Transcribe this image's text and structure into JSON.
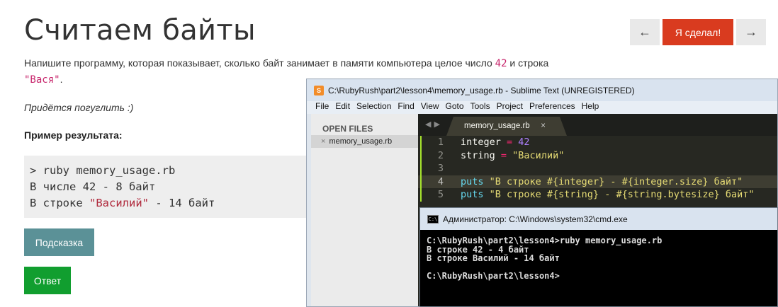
{
  "page": {
    "title": "Считаем байты",
    "nav": {
      "prev": "←",
      "done": "Я сделал!",
      "next": "→"
    },
    "task": {
      "before": "Напишите программу, которая показывает, сколько байт занимает в памяти компьютера целое число ",
      "number": "42",
      "middle": " и строка ",
      "string": "\"Вася\"",
      "after": "."
    },
    "hint_text": "Придётся погуглить :)",
    "example_label": "Пример результата:",
    "example": {
      "line1": "> ruby memory_usage.rb",
      "line2": "В числе 42 - 8 байт",
      "line3_before": "В строке ",
      "line3_str": "\"Василий\"",
      "line3_after": " - 14 байт"
    },
    "buttons": {
      "hint": "Подсказка",
      "answer": "Ответ"
    }
  },
  "sublime": {
    "window_title": "C:\\RubyRush\\part2\\lesson4\\memory_usage.rb - Sublime Text (UNREGISTERED)",
    "menu": [
      "File",
      "Edit",
      "Selection",
      "Find",
      "View",
      "Goto",
      "Tools",
      "Project",
      "Preferences",
      "Help"
    ],
    "sidebar_heading": "OPEN FILES",
    "open_file": "memory_usage.rb",
    "tab_name": "memory_usage.rb",
    "tab_close": "×",
    "gutter": [
      "1",
      "2",
      "3",
      "4",
      "5"
    ],
    "code": {
      "l1_var": "integer ",
      "l1_op": "=",
      "l1_num": " 42",
      "l2_var": "string ",
      "l2_op": "=",
      "l2_str": " \"Василий\"",
      "l4_fn": "puts",
      "l4_str": " \"В строке #{integer} - #{integer.size} байт\"",
      "l5_fn": "puts",
      "l5_str": " \"В строке #{string} - #{string.bytesize} байт\""
    }
  },
  "cmd": {
    "window_title": "Администратор: C:\\Windows\\system32\\cmd.exe",
    "output": "C:\\RubyRush\\part2\\lesson4>ruby memory_usage.rb\nВ строке 42 - 4 байт\nВ строке Василий - 14 байт\n\nC:\\RubyRush\\part2\\lesson4>"
  }
}
